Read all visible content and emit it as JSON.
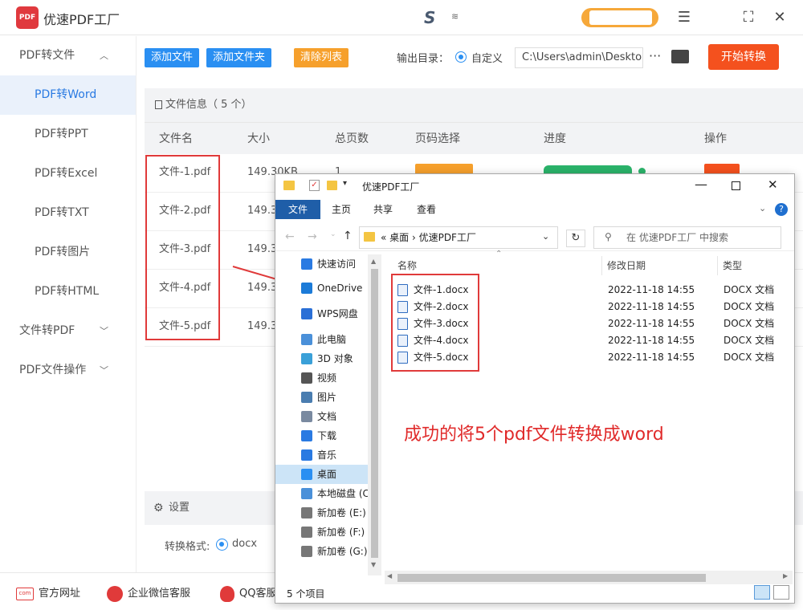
{
  "app": {
    "title": "优速PDF工厂",
    "brand_mark": "S",
    "brand_suffix": "≋",
    "window_controls": [
      "menu-icon",
      "fullscreen-icon",
      "close-icon"
    ]
  },
  "sidebar": {
    "items": [
      {
        "label": "PDF转文件",
        "type": "group",
        "expanded": true
      },
      {
        "label": "PDF转Word",
        "type": "sub",
        "active": true
      },
      {
        "label": "PDF转PPT",
        "type": "sub"
      },
      {
        "label": "PDF转Excel",
        "type": "sub"
      },
      {
        "label": "PDF转TXT",
        "type": "sub"
      },
      {
        "label": "PDF转图片",
        "type": "sub"
      },
      {
        "label": "PDF转HTML",
        "type": "sub"
      },
      {
        "label": "文件转PDF",
        "type": "group",
        "expanded": false
      },
      {
        "label": "PDF文件操作",
        "type": "group",
        "expanded": false
      }
    ]
  },
  "toolbar": {
    "add_file": "添加文件",
    "add_folder": "添加文件夹",
    "clear_list": "清除列表",
    "output_label": "输出目录：",
    "custom_label": "自定义",
    "output_path": "C:\\Users\\admin\\Deskto",
    "more": "···",
    "start": "开始转换"
  },
  "file_list": {
    "header": "文件信息（ 5 个）",
    "columns": [
      "文件名",
      "大小",
      "总页数",
      "页码选择",
      "进度",
      "操作"
    ],
    "rows": [
      {
        "name": "文件-1.pdf",
        "size": "149.30KB",
        "pages": "1"
      },
      {
        "name": "文件-2.pdf",
        "size": "149.3",
        "pages": ""
      },
      {
        "name": "文件-3.pdf",
        "size": "149.3",
        "pages": ""
      },
      {
        "name": "文件-4.pdf",
        "size": "149.3",
        "pages": ""
      },
      {
        "name": "文件-5.pdf",
        "size": "149.3",
        "pages": ""
      }
    ]
  },
  "settings": {
    "label": "设置",
    "format_label": "转换格式:",
    "format_value": "docx"
  },
  "bottom": {
    "website": "官方网址",
    "wechat": "企业微信客服",
    "qq": "QQ客服"
  },
  "explorer": {
    "title": "优速PDF工厂",
    "ribbon_tabs": [
      "文件",
      "主页",
      "共享",
      "查看"
    ],
    "address": "« 桌面 › 优速PDF工厂",
    "search_placeholder": "在 优速PDF工厂 中搜索",
    "nav": [
      {
        "label": "快速访问",
        "icon": "star-icon",
        "color": "#2a7ae2"
      },
      {
        "label": "OneDrive",
        "icon": "cloud-icon",
        "color": "#1c7bd8"
      },
      {
        "label": "WPS网盘",
        "icon": "cloud-icon",
        "color": "#2a6fd6"
      },
      {
        "label": "此电脑",
        "icon": "computer-icon",
        "color": "#4a90d9"
      },
      {
        "label": "3D 对象",
        "icon": "cube-icon",
        "color": "#3aa0d8"
      },
      {
        "label": "视频",
        "icon": "video-icon",
        "color": "#555555"
      },
      {
        "label": "图片",
        "icon": "picture-icon",
        "color": "#4a7db0"
      },
      {
        "label": "文档",
        "icon": "document-icon",
        "color": "#7a8aa0"
      },
      {
        "label": "下载",
        "icon": "download-icon",
        "color": "#2a7ae2"
      },
      {
        "label": "音乐",
        "icon": "music-icon",
        "color": "#2a7ae2"
      },
      {
        "label": "桌面",
        "icon": "desktop-icon",
        "color": "#2a8ff2",
        "selected": true
      },
      {
        "label": "本地磁盘 (C",
        "icon": "drive-icon",
        "color": "#4a90d9"
      },
      {
        "label": "新加卷 (E:)",
        "icon": "drive-icon",
        "color": "#777777"
      },
      {
        "label": "新加卷 (F:)",
        "icon": "drive-icon",
        "color": "#777777"
      },
      {
        "label": "新加卷 (G:)",
        "icon": "drive-icon",
        "color": "#777777"
      }
    ],
    "columns": [
      "名称",
      "修改日期",
      "类型"
    ],
    "files": [
      {
        "name": "文件-1.docx",
        "date": "2022-11-18 14:55",
        "type": "DOCX 文档"
      },
      {
        "name": "文件-2.docx",
        "date": "2022-11-18 14:55",
        "type": "DOCX 文档"
      },
      {
        "name": "文件-3.docx",
        "date": "2022-11-18 14:55",
        "type": "DOCX 文档"
      },
      {
        "name": "文件-4.docx",
        "date": "2022-11-18 14:55",
        "type": "DOCX 文档"
      },
      {
        "name": "文件-5.docx",
        "date": "2022-11-18 14:55",
        "type": "DOCX 文档"
      }
    ],
    "status": "5 个项目"
  },
  "annotation": {
    "success_text": "成功的将5个pdf文件转换成word"
  },
  "colors": {
    "accent_blue": "#2a8ff2",
    "accent_orange": "#f6a02c",
    "start_red": "#f4511e",
    "annotation_red": "#e03a3a"
  }
}
